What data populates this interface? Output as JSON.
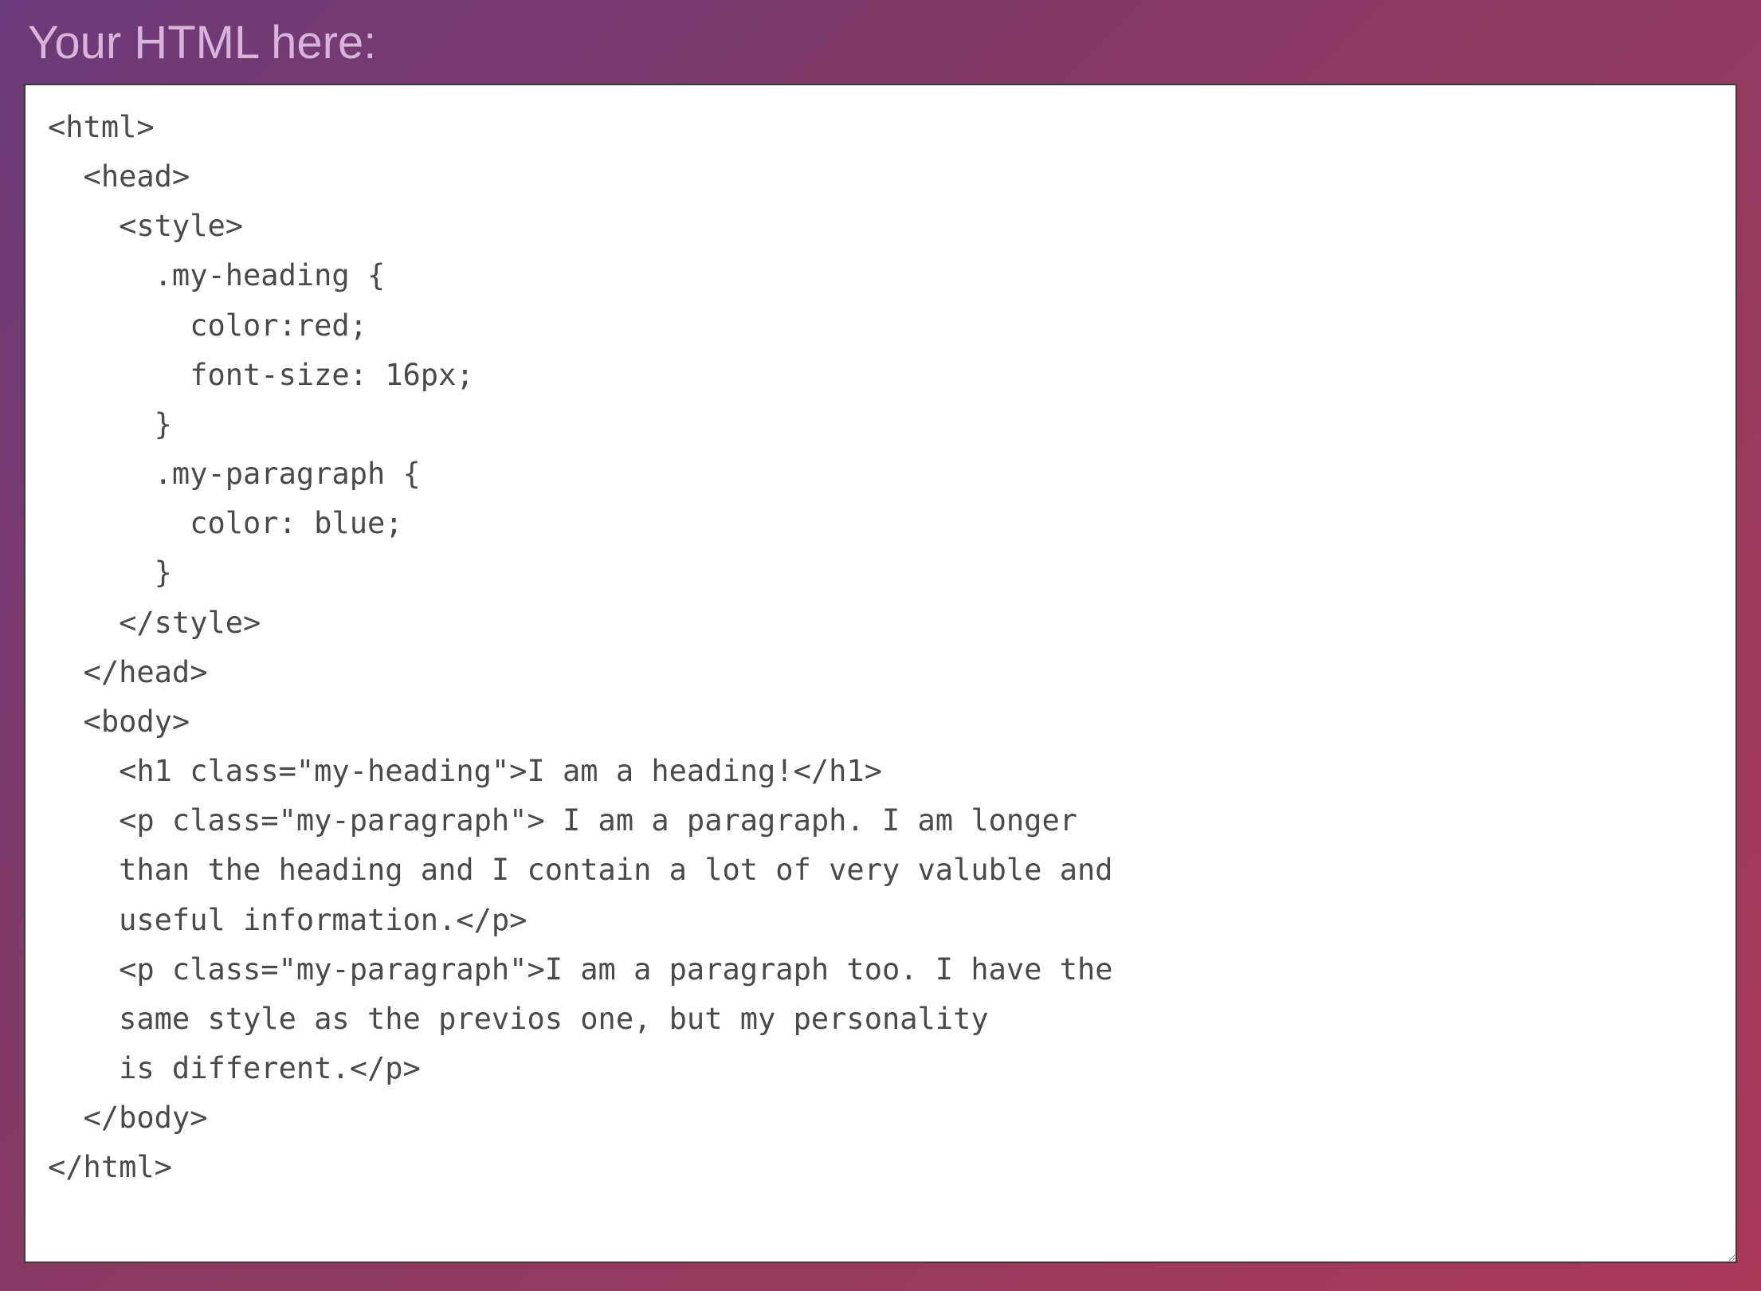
{
  "label": "Your HTML here:",
  "code": "<html>\n  <head>\n    <style>\n      .my-heading {\n        color:red;\n        font-size: 16px;\n      }\n      .my-paragraph {\n        color: blue;\n      }\n    </style>\n  </head>\n  <body>\n    <h1 class=\"my-heading\">I am a heading!</h1>\n    <p class=\"my-paragraph\"> I am a paragraph. I am longer\n    than the heading and I contain a lot of very valuble and\n    useful information.</p>\n    <p class=\"my-paragraph\">I am a paragraph too. I have the\n    same style as the previos one, but my personality\n    is different.</p>\n  </body>\n</html>"
}
